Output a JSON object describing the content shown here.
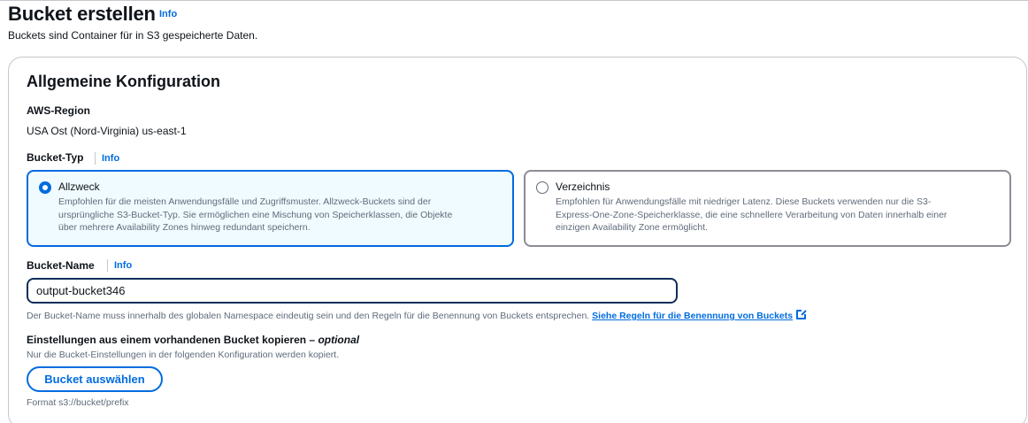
{
  "header": {
    "title": "Bucket erstellen",
    "info": "Info",
    "description": "Buckets sind Container für in S3 gespeicherte Daten."
  },
  "general": {
    "title": "Allgemeine Konfiguration",
    "region_label": "AWS-Region",
    "region_value": "USA Ost (Nord-Virginia) us-east-1",
    "bucket_type_label": "Bucket-Typ",
    "bucket_type_info": "Info",
    "types": [
      {
        "title": "Allzweck",
        "selected": true,
        "desc_lines": [
          "Empfohlen für die meisten Anwendungsfälle und Zugriffsmuster. Allzweck-Buckets sind der",
          "ursprüngliche S3-Bucket-Typ. Sie ermöglichen eine Mischung von Speicherklassen, die Objekte",
          "über mehrere Availability Zones hinweg redundant speichern."
        ]
      },
      {
        "title": "Verzeichnis",
        "selected": false,
        "desc_lines": [
          "Empfohlen für Anwendungsfälle mit niedriger Latenz. Diese Buckets verwenden nur die S3-",
          "Express-One-Zone-Speicherklasse, die eine schnellere Verarbeitung von Daten innerhalb einer",
          "einzigen Availability Zone ermöglicht."
        ]
      }
    ],
    "bucket_name_label": "Bucket-Name",
    "bucket_name_info": "Info",
    "bucket_name_value": "output-bucket346",
    "bucket_name_hint": "Der Bucket-Name muss innerhalb des globalen Namespace eindeutig sein und den Regeln für die Benennung von Buckets entsprechen.",
    "bucket_name_rules_link": "Siehe Regeln für die Benennung von Buckets",
    "copy_title": "Einstellungen aus einem vorhandenen Bucket kopieren –",
    "copy_optional": "optional",
    "copy_desc": "Nur die Bucket-Einstellungen in der folgenden Konfiguration werden kopiert.",
    "choose_button": "Bucket auswählen",
    "format_hint": "Format s3://bucket/prefix"
  },
  "colors": {
    "accent": "#006ce0",
    "selected_tile_bg": "#f0fbff",
    "text": "#0f141a",
    "secondary_text": "#5f6b7a"
  }
}
